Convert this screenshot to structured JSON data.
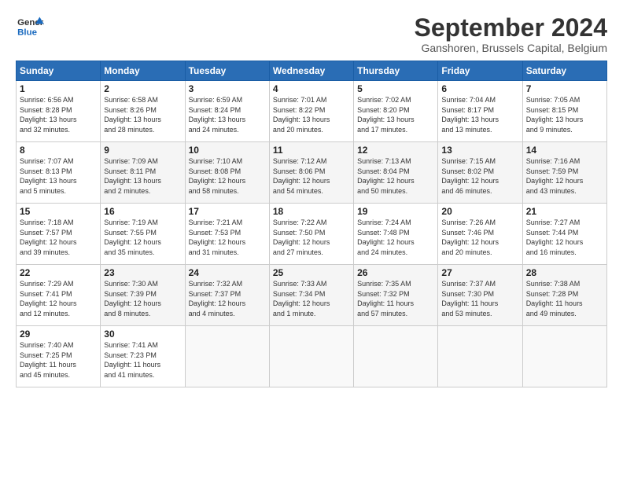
{
  "header": {
    "logo_line1": "General",
    "logo_line2": "Blue",
    "month": "September 2024",
    "location": "Ganshoren, Brussels Capital, Belgium"
  },
  "days_of_week": [
    "Sunday",
    "Monday",
    "Tuesday",
    "Wednesday",
    "Thursday",
    "Friday",
    "Saturday"
  ],
  "weeks": [
    [
      {
        "day": "1",
        "info": "Sunrise: 6:56 AM\nSunset: 8:28 PM\nDaylight: 13 hours\nand 32 minutes."
      },
      {
        "day": "2",
        "info": "Sunrise: 6:58 AM\nSunset: 8:26 PM\nDaylight: 13 hours\nand 28 minutes."
      },
      {
        "day": "3",
        "info": "Sunrise: 6:59 AM\nSunset: 8:24 PM\nDaylight: 13 hours\nand 24 minutes."
      },
      {
        "day": "4",
        "info": "Sunrise: 7:01 AM\nSunset: 8:22 PM\nDaylight: 13 hours\nand 20 minutes."
      },
      {
        "day": "5",
        "info": "Sunrise: 7:02 AM\nSunset: 8:20 PM\nDaylight: 13 hours\nand 17 minutes."
      },
      {
        "day": "6",
        "info": "Sunrise: 7:04 AM\nSunset: 8:17 PM\nDaylight: 13 hours\nand 13 minutes."
      },
      {
        "day": "7",
        "info": "Sunrise: 7:05 AM\nSunset: 8:15 PM\nDaylight: 13 hours\nand 9 minutes."
      }
    ],
    [
      {
        "day": "8",
        "info": "Sunrise: 7:07 AM\nSunset: 8:13 PM\nDaylight: 13 hours\nand 5 minutes."
      },
      {
        "day": "9",
        "info": "Sunrise: 7:09 AM\nSunset: 8:11 PM\nDaylight: 13 hours\nand 2 minutes."
      },
      {
        "day": "10",
        "info": "Sunrise: 7:10 AM\nSunset: 8:08 PM\nDaylight: 12 hours\nand 58 minutes."
      },
      {
        "day": "11",
        "info": "Sunrise: 7:12 AM\nSunset: 8:06 PM\nDaylight: 12 hours\nand 54 minutes."
      },
      {
        "day": "12",
        "info": "Sunrise: 7:13 AM\nSunset: 8:04 PM\nDaylight: 12 hours\nand 50 minutes."
      },
      {
        "day": "13",
        "info": "Sunrise: 7:15 AM\nSunset: 8:02 PM\nDaylight: 12 hours\nand 46 minutes."
      },
      {
        "day": "14",
        "info": "Sunrise: 7:16 AM\nSunset: 7:59 PM\nDaylight: 12 hours\nand 43 minutes."
      }
    ],
    [
      {
        "day": "15",
        "info": "Sunrise: 7:18 AM\nSunset: 7:57 PM\nDaylight: 12 hours\nand 39 minutes."
      },
      {
        "day": "16",
        "info": "Sunrise: 7:19 AM\nSunset: 7:55 PM\nDaylight: 12 hours\nand 35 minutes."
      },
      {
        "day": "17",
        "info": "Sunrise: 7:21 AM\nSunset: 7:53 PM\nDaylight: 12 hours\nand 31 minutes."
      },
      {
        "day": "18",
        "info": "Sunrise: 7:22 AM\nSunset: 7:50 PM\nDaylight: 12 hours\nand 27 minutes."
      },
      {
        "day": "19",
        "info": "Sunrise: 7:24 AM\nSunset: 7:48 PM\nDaylight: 12 hours\nand 24 minutes."
      },
      {
        "day": "20",
        "info": "Sunrise: 7:26 AM\nSunset: 7:46 PM\nDaylight: 12 hours\nand 20 minutes."
      },
      {
        "day": "21",
        "info": "Sunrise: 7:27 AM\nSunset: 7:44 PM\nDaylight: 12 hours\nand 16 minutes."
      }
    ],
    [
      {
        "day": "22",
        "info": "Sunrise: 7:29 AM\nSunset: 7:41 PM\nDaylight: 12 hours\nand 12 minutes."
      },
      {
        "day": "23",
        "info": "Sunrise: 7:30 AM\nSunset: 7:39 PM\nDaylight: 12 hours\nand 8 minutes."
      },
      {
        "day": "24",
        "info": "Sunrise: 7:32 AM\nSunset: 7:37 PM\nDaylight: 12 hours\nand 4 minutes."
      },
      {
        "day": "25",
        "info": "Sunrise: 7:33 AM\nSunset: 7:34 PM\nDaylight: 12 hours\nand 1 minute."
      },
      {
        "day": "26",
        "info": "Sunrise: 7:35 AM\nSunset: 7:32 PM\nDaylight: 11 hours\nand 57 minutes."
      },
      {
        "day": "27",
        "info": "Sunrise: 7:37 AM\nSunset: 7:30 PM\nDaylight: 11 hours\nand 53 minutes."
      },
      {
        "day": "28",
        "info": "Sunrise: 7:38 AM\nSunset: 7:28 PM\nDaylight: 11 hours\nand 49 minutes."
      }
    ],
    [
      {
        "day": "29",
        "info": "Sunrise: 7:40 AM\nSunset: 7:25 PM\nDaylight: 11 hours\nand 45 minutes."
      },
      {
        "day": "30",
        "info": "Sunrise: 7:41 AM\nSunset: 7:23 PM\nDaylight: 11 hours\nand 41 minutes."
      },
      {
        "day": "",
        "info": ""
      },
      {
        "day": "",
        "info": ""
      },
      {
        "day": "",
        "info": ""
      },
      {
        "day": "",
        "info": ""
      },
      {
        "day": "",
        "info": ""
      }
    ]
  ]
}
